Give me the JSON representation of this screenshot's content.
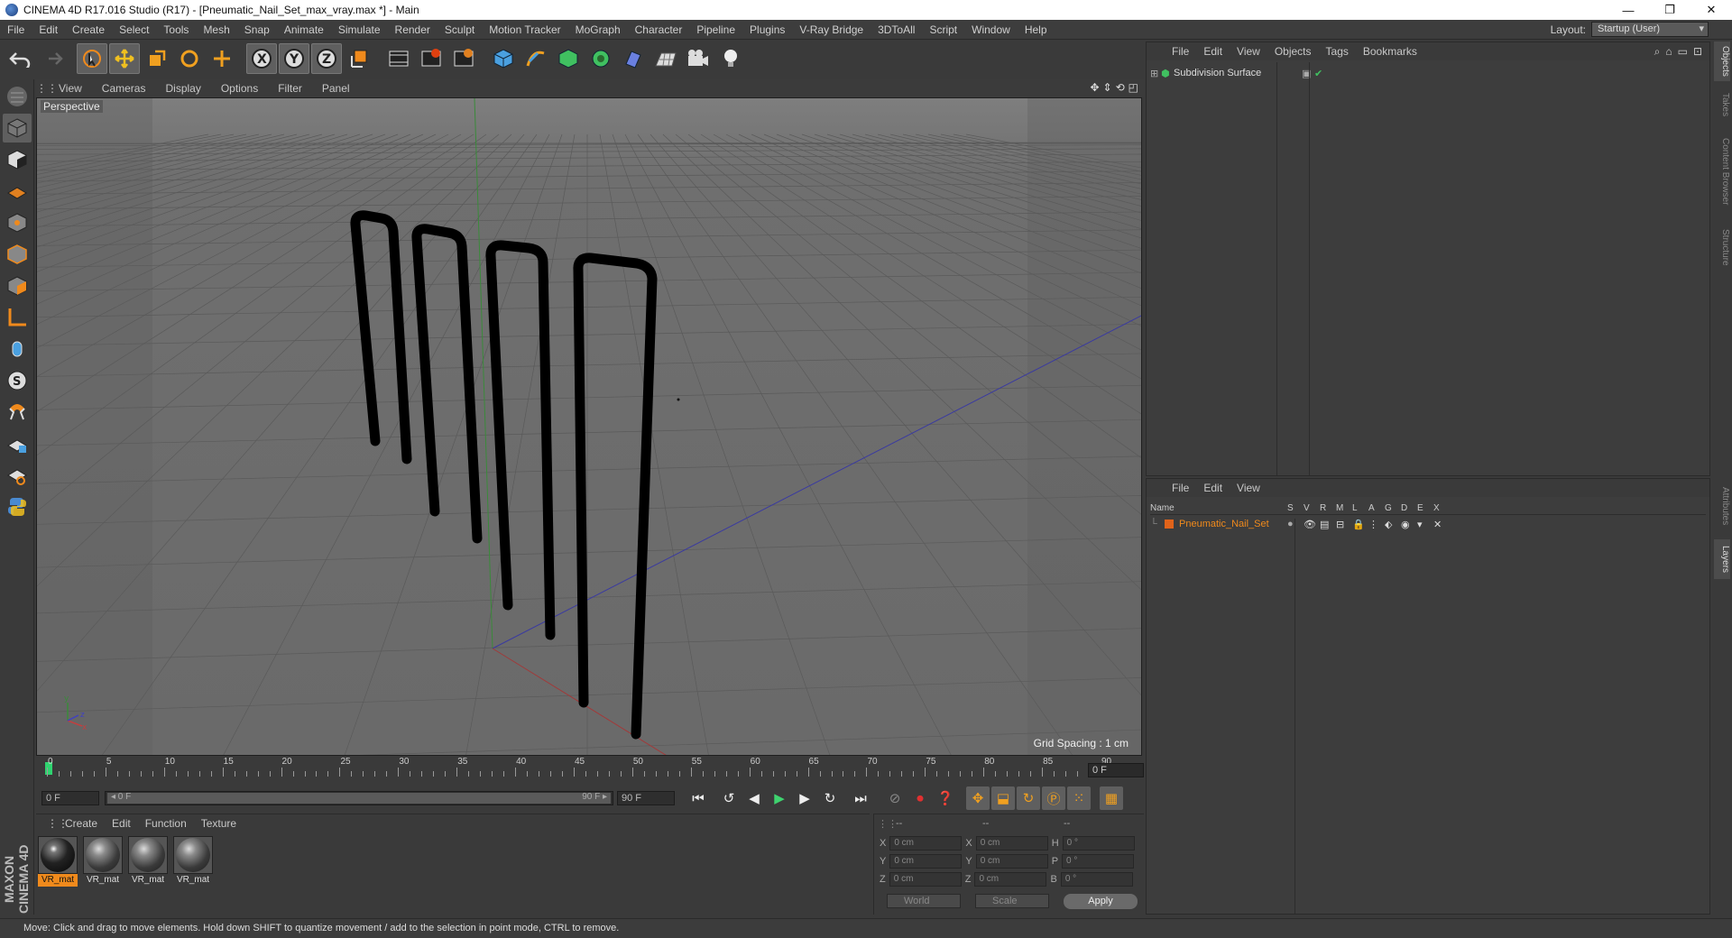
{
  "window": {
    "title": "CINEMA 4D R17.016 Studio (R17) - [Pneumatic_Nail_Set_max_vray.max *] - Main",
    "min": "—",
    "restore": "❐",
    "close": "✕"
  },
  "menu": [
    "File",
    "Edit",
    "Create",
    "Select",
    "Tools",
    "Mesh",
    "Snap",
    "Animate",
    "Simulate",
    "Render",
    "Sculpt",
    "Motion Tracker",
    "MoGraph",
    "Character",
    "Pipeline",
    "Plugins",
    "V-Ray Bridge",
    "3DToAll",
    "Script",
    "Window",
    "Help"
  ],
  "layout": {
    "label": "Layout:",
    "value": "Startup (User)"
  },
  "viewport": {
    "menu": [
      "View",
      "Cameras",
      "Display",
      "Options",
      "Filter",
      "Panel"
    ],
    "label": "Perspective",
    "grid_spacing": "Grid Spacing : 1 cm"
  },
  "timeline": {
    "ticks": [
      "0",
      "5",
      "10",
      "15",
      "20",
      "25",
      "30",
      "35",
      "40",
      "45",
      "50",
      "55",
      "60",
      "65",
      "70",
      "75",
      "80",
      "85",
      "90"
    ],
    "frame": "0 F",
    "start": "0 F",
    "range_left": "◂ 0 F",
    "range_right": "90 F ▸",
    "end": "90 F"
  },
  "materials": {
    "menu": [
      "Create",
      "Edit",
      "Function",
      "Texture"
    ],
    "items": [
      {
        "name": "VR_mat",
        "selected": true
      },
      {
        "name": "VR_mat",
        "selected": false
      },
      {
        "name": "VR_mat",
        "selected": false
      },
      {
        "name": "VR_mat",
        "selected": false
      }
    ]
  },
  "coords": {
    "headers": [
      "--",
      "--",
      "--"
    ],
    "rows": [
      {
        "a": "X",
        "av": "0 cm",
        "b": "X",
        "bv": "0 cm",
        "c": "H",
        "cv": "0 °"
      },
      {
        "a": "Y",
        "av": "0 cm",
        "b": "Y",
        "bv": "0 cm",
        "c": "P",
        "cv": "0 °"
      },
      {
        "a": "Z",
        "av": "0 cm",
        "b": "Z",
        "bv": "0 cm",
        "c": "B",
        "cv": "0 °"
      }
    ],
    "world": "World",
    "scale": "Scale",
    "apply": "Apply"
  },
  "objects": {
    "menu": [
      "File",
      "Edit",
      "View",
      "Objects",
      "Tags",
      "Bookmarks"
    ],
    "items": [
      {
        "name": "Subdivision Surface"
      }
    ]
  },
  "layers": {
    "menu": [
      "File",
      "Edit",
      "View"
    ],
    "headers": [
      "Name",
      "S",
      "V",
      "R",
      "M",
      "L",
      "A",
      "G",
      "D",
      "E",
      "X"
    ],
    "items": [
      {
        "name": "Pneumatic_Nail_Set",
        "color": "#e0631a"
      }
    ]
  },
  "side_tabs": [
    "Objects",
    "Takes",
    "Content Browser",
    "Structure",
    "Attributes",
    "Layers"
  ],
  "status": "Move: Click and drag to move elements. Hold down SHIFT to quantize movement / add to the selection in point mode, CTRL to remove.",
  "brand": "MAXON CINEMA 4D"
}
